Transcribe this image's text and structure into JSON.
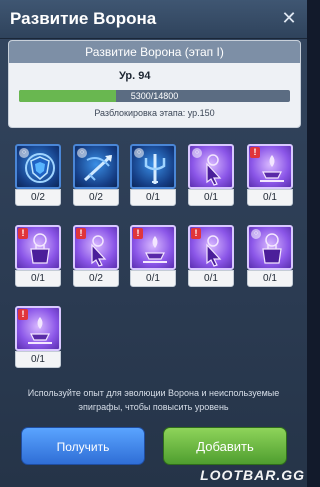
{
  "header": {
    "title": "Развитие Ворона"
  },
  "card": {
    "title": "Развитие Ворона (этап I)",
    "level": "Ур. 94",
    "progress_text": "5300/14800",
    "progress_fraction": 0.358,
    "unlock_text": "Разблокировка этапа: ур.150"
  },
  "slots": [
    {
      "count": "0/2",
      "style": "blue",
      "icon": "shield-icon",
      "badge": "ring"
    },
    {
      "count": "0/2",
      "style": "blue",
      "icon": "crossbow-icon",
      "badge": "ring"
    },
    {
      "count": "0/1",
      "style": "blue",
      "icon": "trident-icon",
      "badge": "ring"
    },
    {
      "count": "0/1",
      "style": "purple",
      "icon": "cursor-icon",
      "badge": "ring"
    },
    {
      "count": "0/1",
      "style": "purple",
      "icon": "altar-icon",
      "badge": "alert"
    },
    {
      "count": "0/1",
      "style": "purple",
      "icon": "fortress-icon",
      "badge": "alert"
    },
    {
      "count": "0/2",
      "style": "purple",
      "icon": "cursor-icon",
      "badge": "alert"
    },
    {
      "count": "0/1",
      "style": "purple",
      "icon": "altar-icon",
      "badge": "alert"
    },
    {
      "count": "0/1",
      "style": "purple",
      "icon": "cursor-icon",
      "badge": "alert"
    },
    {
      "count": "0/1",
      "style": "purple",
      "icon": "fortress-icon",
      "badge": "ring"
    },
    {
      "count": "0/1",
      "style": "purple",
      "icon": "altar-icon",
      "badge": "alert"
    }
  ],
  "hint": "Используйте опыт для эволюции Ворона и неиспользуемые эпиграфы, чтобы повысить уровень",
  "buttons": {
    "get": "Получить",
    "add": "Добавить"
  },
  "watermark": "LOOTBAR.GG",
  "colors": {
    "accent_green": "#69b750",
    "accent_blue": "#2f6ed6",
    "alert_red": "#e0353b"
  }
}
